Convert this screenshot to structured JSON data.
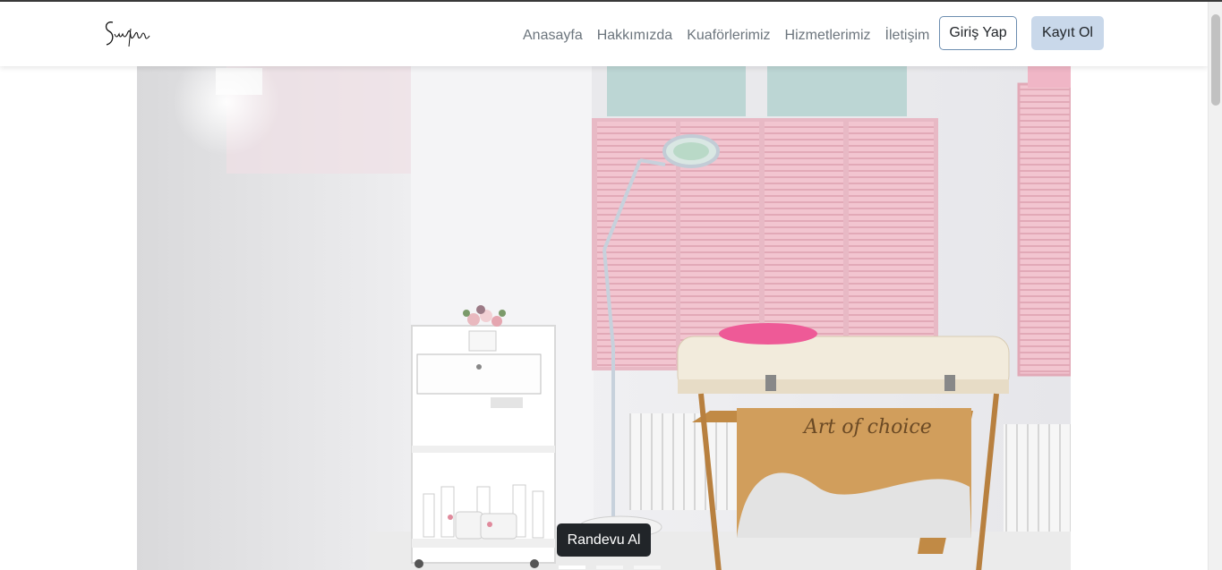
{
  "brand": {
    "logo_text": "Sunfem"
  },
  "nav": {
    "links": [
      "Anasayfa",
      "Hakkımızda",
      "Kuaförlerimiz",
      "Hizmetlerimiz",
      "İletişim"
    ],
    "login_label": "Giriş Yap",
    "register_label": "Kayıt Ol"
  },
  "hero": {
    "cta_label": "Randevu Al",
    "bed_print": "Art of choice",
    "carousel_count": 3,
    "active_slide": 0
  },
  "colors": {
    "navbar_bg": "#ffffff",
    "nav_link": "#6c757d",
    "login_border": "#6c8db0",
    "register_bg": "#c9d8ea",
    "cta_bg": "#212529",
    "shutter_pink": "#f2c5d0"
  }
}
